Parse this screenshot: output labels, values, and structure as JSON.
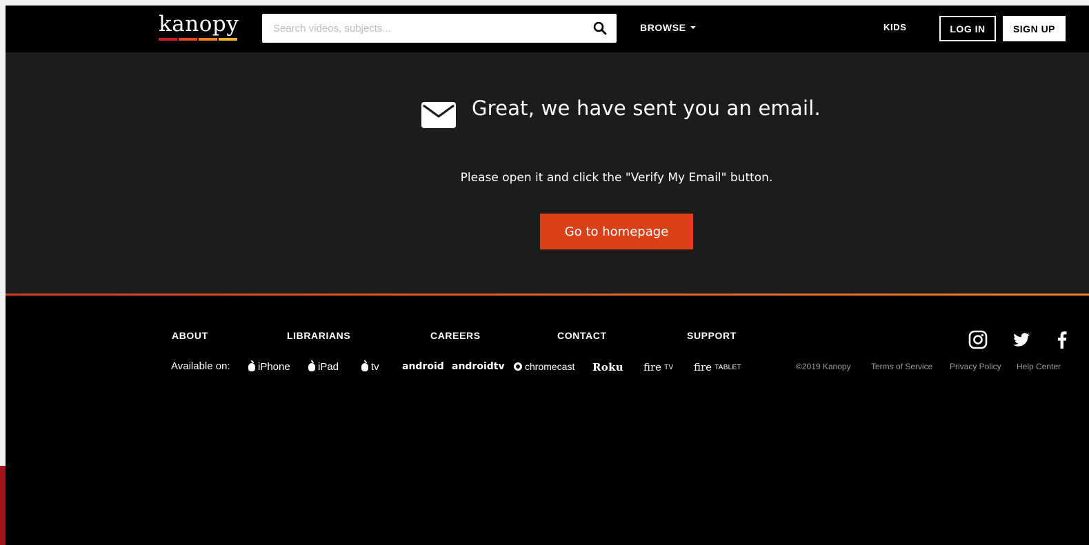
{
  "header": {
    "logo_text": "kanopy",
    "logo_colors": [
      "#c8202a",
      "#e6491d",
      "#ef7f1a",
      "#f7b125"
    ],
    "search_placeholder": "Search videos, subjects...",
    "browse_label": "BROWSE",
    "kids_label": "KIDS",
    "login_label": "LOG IN",
    "signup_label": "SIGN UP"
  },
  "main": {
    "headline": "Great, we have sent you an email.",
    "instruction": "Please open it and click the \"Verify My Email\" button.",
    "button_label": "Go to homepage"
  },
  "footer": {
    "links": [
      "ABOUT",
      "LIBRARIANS",
      "CAREERS",
      "CONTACT",
      "SUPPORT"
    ],
    "available_label": "Available on:",
    "platforms": {
      "iphone": "iPhone",
      "ipad": "iPad",
      "appletv": "tv",
      "android": "android",
      "androidtv": "androidtv",
      "chromecast": "chromecast",
      "roku": "Roku",
      "firetv_main": "fire",
      "firetv_sub": "TV",
      "firetablet_main": "fire",
      "firetablet_sub": "TABLET"
    },
    "legal": [
      "©2019 Kanopy",
      "Terms of Service",
      "Privacy Policy",
      "Help Center"
    ],
    "social_icons": [
      "instagram-icon",
      "twitter-icon",
      "facebook-icon"
    ]
  },
  "colors": {
    "accent_button": "#d94118",
    "divider_start": "#d2421d",
    "divider_end": "#e8812f",
    "main_bg": "#1c1c1c",
    "footer_bg": "#000000"
  }
}
